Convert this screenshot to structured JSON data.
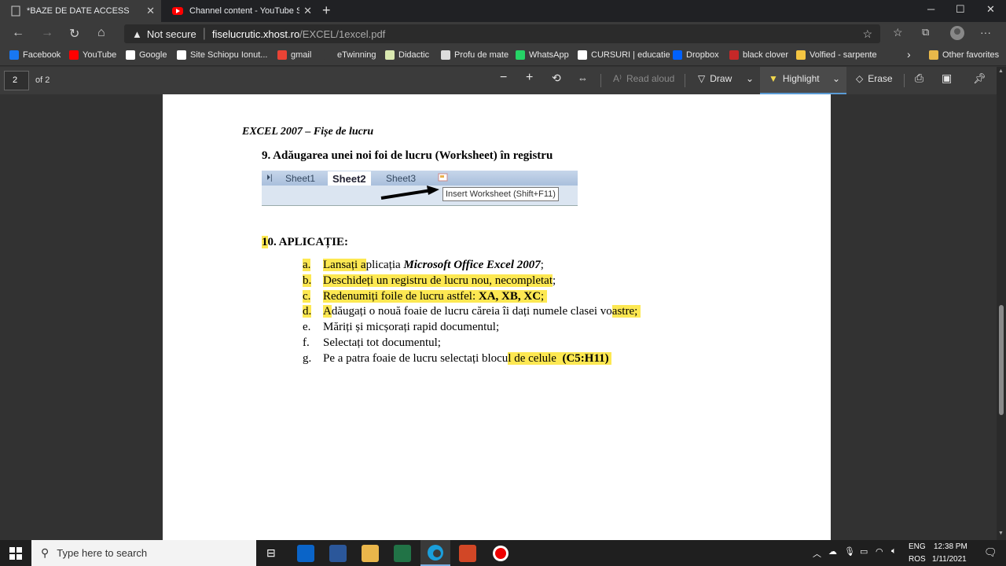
{
  "tabs": [
    {
      "title": "*BAZE DE DATE ACCESS",
      "active": true
    },
    {
      "title": "Channel content - YouTube Stud",
      "active": false
    }
  ],
  "address": {
    "security": "Not secure",
    "host": "fiselucrutic.xhost.ro",
    "path": "/EXCEL/1excel.pdf"
  },
  "bookmarks": [
    {
      "label": "Facebook",
      "color": "#1877f2"
    },
    {
      "label": "YouTube",
      "color": "#ff0000"
    },
    {
      "label": "Google",
      "color": "#ffffff"
    },
    {
      "label": "Site Schiopu Ionut...",
      "color": "#ffffff"
    },
    {
      "label": "gmail",
      "color": "#ea4335"
    },
    {
      "label": "eTwinning",
      "color": "#3b3b3b"
    },
    {
      "label": "Didactic",
      "color": "#d9e8b0"
    },
    {
      "label": "Profu de mate",
      "color": "#dddddd"
    },
    {
      "label": "WhatsApp",
      "color": "#25d366"
    },
    {
      "label": "CURSURI | educatie",
      "color": "#ffffff"
    },
    {
      "label": "Dropbox",
      "color": "#0061fe"
    },
    {
      "label": "black clover",
      "color": "#c62828"
    },
    {
      "label": "Volfied - sarpente",
      "color": "#f4c542"
    }
  ],
  "other_favorites": "Other favorites",
  "pdf_toolbar": {
    "page": "2",
    "of": "of 2",
    "read_aloud": "Read aloud",
    "draw": "Draw",
    "highlight": "Highlight",
    "erase": "Erase"
  },
  "document": {
    "header": "EXCEL 2007 – Fișe de lucru",
    "section9": "9.   Adăugarea unei noi foi de lucru (Worksheet) în registru",
    "sheet_tabs": [
      "Sheet1",
      "Sheet2",
      "Sheet3"
    ],
    "tooltip": "Insert Worksheet (Shift+F11)",
    "section10_num": "1",
    "section10_rest": "0. APLICAȚIE:",
    "items": [
      {
        "letter": "a.",
        "parts": [
          {
            "t": "Lansați a",
            "hl": true
          },
          {
            "t": "plicația ",
            "hl": false
          },
          {
            "t": "Microsoft Office Excel 2007",
            "hl": false,
            "bi": true
          },
          {
            "t": ";",
            "hl": false
          }
        ],
        "lhl": true
      },
      {
        "letter": "b.",
        "parts": [
          {
            "t": "Deschideți un registru de lucru nou, necompletat",
            "hl": true
          },
          {
            "t": ";",
            "hl": false
          }
        ],
        "lhl": true
      },
      {
        "letter": "c.",
        "parts": [
          {
            "t": "Redenumiți foile de lucru astfel: ",
            "hl": true
          },
          {
            "t": "XA, XB, XC",
            "hl": true,
            "b": true
          },
          {
            "t": "; ",
            "hl": true
          }
        ],
        "lhl": true
      },
      {
        "letter": "d.",
        "parts": [
          {
            "t": "A",
            "hl": true
          },
          {
            "t": "dăugați o nouă foaie de lucru căreia îi dați numele clasei vo",
            "hl": false
          },
          {
            "t": "astre; ",
            "hl": true
          }
        ],
        "lhl": true
      },
      {
        "letter": "e.",
        "parts": [
          {
            "t": "Măriți și micșorați rapid documentul;",
            "hl": false
          }
        ],
        "lhl": false
      },
      {
        "letter": "f.",
        "parts": [
          {
            "t": "Selectați tot documentul;",
            "hl": false
          }
        ],
        "lhl": false
      },
      {
        "letter": "g.",
        "parts": [
          {
            "t": "Pe a patra foaie de lucru selectați blocu",
            "hl": false
          },
          {
            "t": "l de celule  ",
            "hl": true
          },
          {
            "t": "(C5:H11) ",
            "hl": true,
            "b": true
          }
        ],
        "lhl": false
      }
    ]
  },
  "taskbar": {
    "search_placeholder": "Type here to search",
    "lang1": "ENG",
    "lang2": "ROS",
    "time": "12:38 PM",
    "date": "1/11/2021"
  },
  "colors": {
    "highlight": "#fde852",
    "accent": "#5a9bd5"
  }
}
